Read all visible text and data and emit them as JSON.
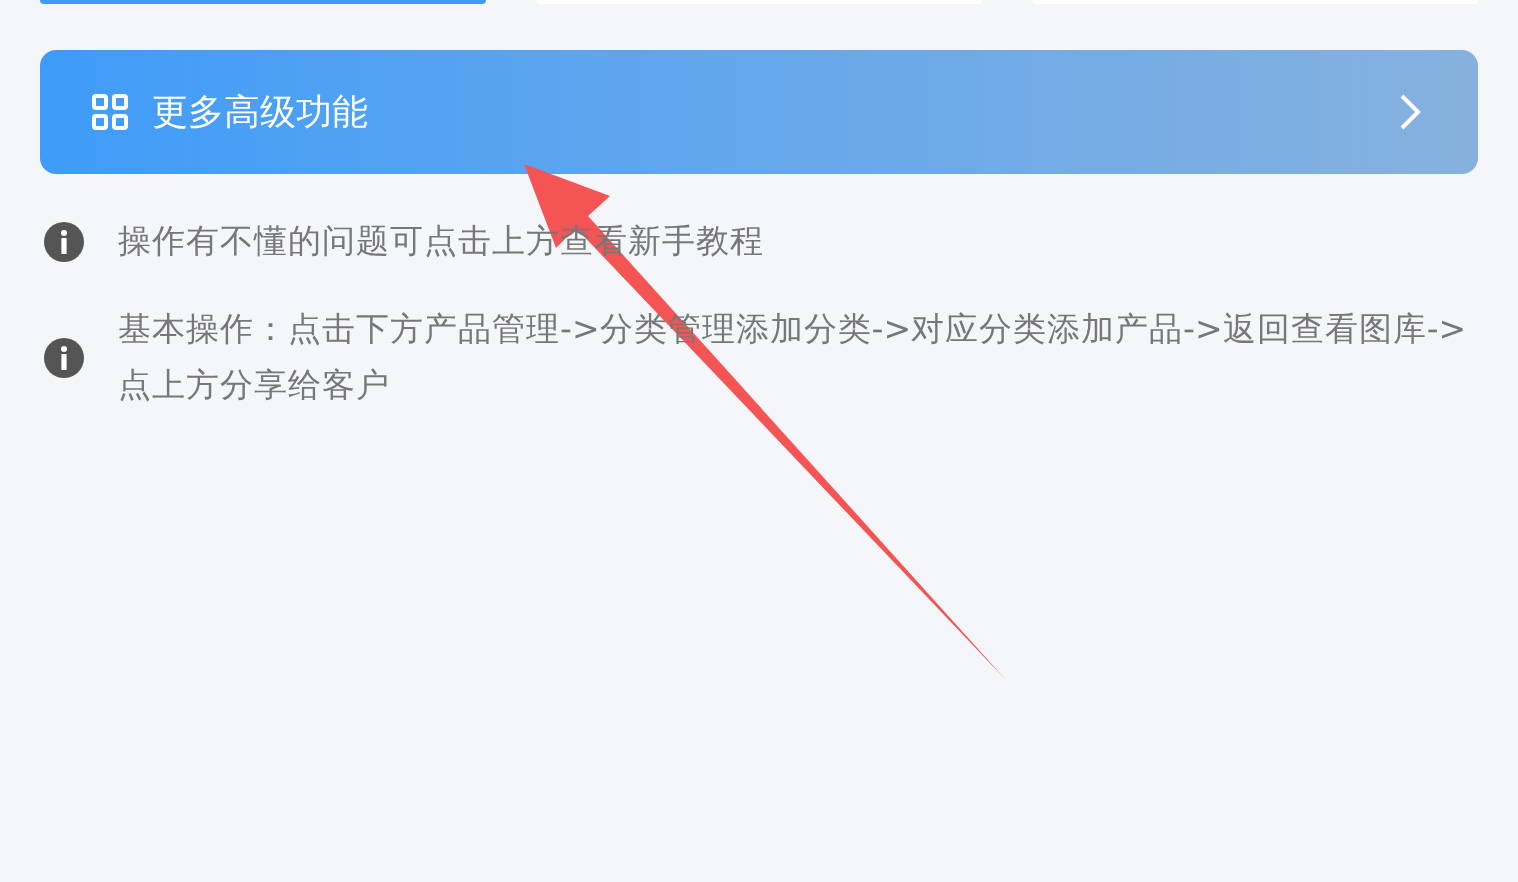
{
  "top_buttons": [
    {
      "selected": true
    },
    {
      "selected": false
    },
    {
      "selected": false
    }
  ],
  "feature_bar": {
    "label": "更多高级功能"
  },
  "tips": [
    "操作有不懂的问题可点击上方查看新手教程",
    "基本操作：点击下方产品管理->分类管理添加分类->对应分类添加产品->返回查看图库->点上方分享给客户"
  ]
}
